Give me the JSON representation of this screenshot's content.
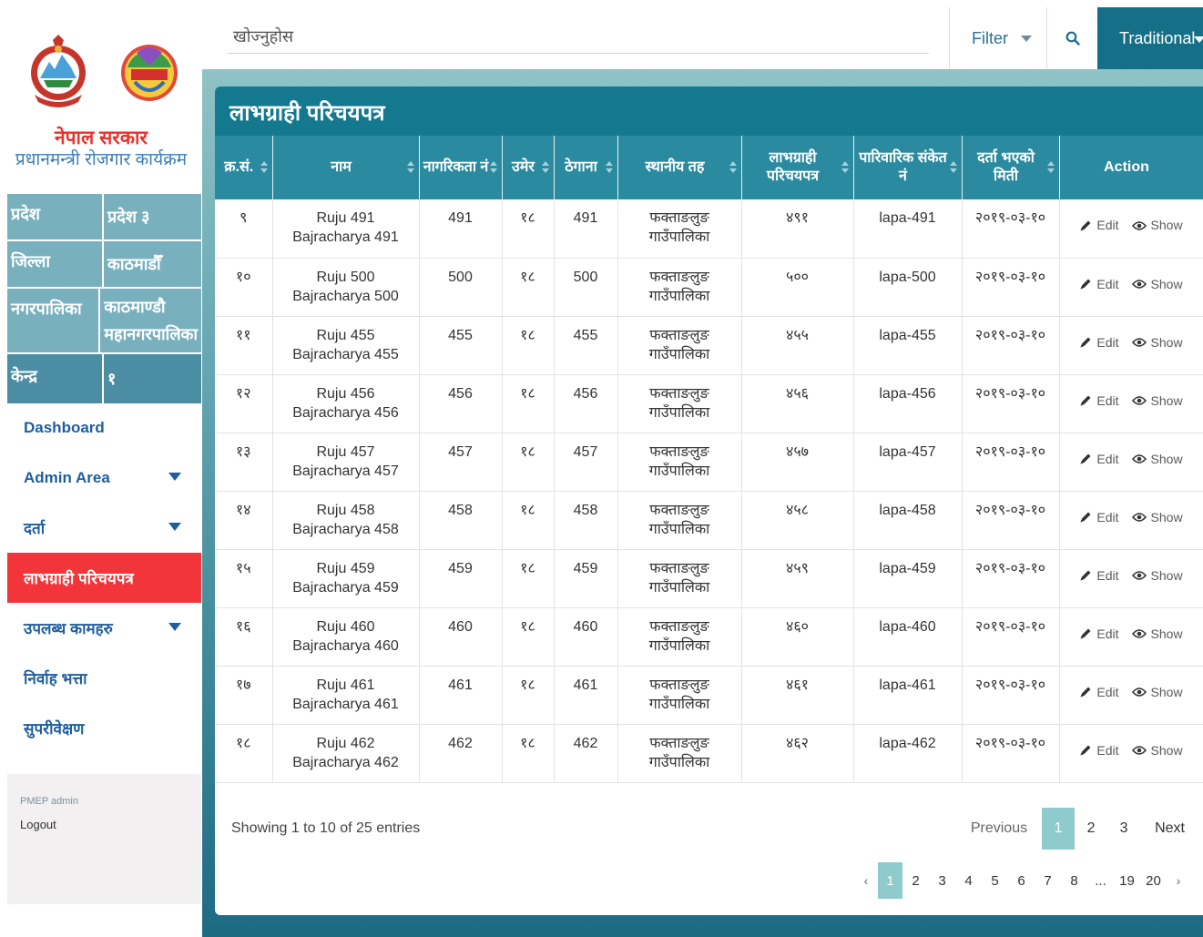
{
  "sidebar": {
    "org_title": "नेपाल सरकार",
    "org_subtitle": "प्रधानमन्त्री रोजगार कार्यक्रम",
    "logo_text": "रोजगार कार्यक्रम",
    "info": [
      {
        "key": "प्रदेश",
        "value": "प्रदेश ३"
      },
      {
        "key": "जिल्ला",
        "value": "काठमाडौँ"
      },
      {
        "key": "नगरपालिका",
        "value": "काठमाण्डौ महानगरपालिका"
      },
      {
        "key": "केन्द्र",
        "value": "१"
      }
    ],
    "nav": [
      {
        "label": "Dashboard"
      },
      {
        "label": "Admin Area"
      },
      {
        "label": "दर्ता"
      },
      {
        "label": "लाभग्राही परिचयपत्र"
      },
      {
        "label": "उपलब्ध कामहरु"
      },
      {
        "label": "निर्वाह भत्ता"
      },
      {
        "label": "सुपरीवेक्षण"
      }
    ],
    "user": "PMEP admin",
    "logout": "Logout"
  },
  "topbar": {
    "search_placeholder": "खोज्नुहोस",
    "filter_label": "Filter",
    "mode_label": "Traditional"
  },
  "card": {
    "title": "लाभग्राही परिचयपत्र",
    "columns": [
      "क्र.सं.",
      "नाम",
      "नागरिकता नं",
      "उमेर",
      "ठेगाना",
      "स्थानीय तह",
      "लाभग्राही परिचयपत्र",
      "पारिवारिक संकेत नं",
      "दर्ता भएको मिती",
      "Action"
    ],
    "rows": [
      {
        "sn": "९",
        "name": "Ruju 491 Bajracharya 491",
        "citizenship": "491",
        "age": "१८",
        "address": "491",
        "local": "फक्ताङलुङ गाउँपालिका",
        "card": "४९१",
        "family": "lapa-491",
        "date": "२०१९-०३-१०"
      },
      {
        "sn": "१०",
        "name": "Ruju 500 Bajracharya 500",
        "citizenship": "500",
        "age": "१८",
        "address": "500",
        "local": "फक्ताङलुङ गाउँपालिका",
        "card": "५००",
        "family": "lapa-500",
        "date": "२०१९-०३-१०"
      },
      {
        "sn": "११",
        "name": "Ruju 455 Bajracharya 455",
        "citizenship": "455",
        "age": "१८",
        "address": "455",
        "local": "फक्ताङलुङ गाउँपालिका",
        "card": "४५५",
        "family": "lapa-455",
        "date": "२०१९-०३-१०"
      },
      {
        "sn": "१२",
        "name": "Ruju 456 Bajracharya 456",
        "citizenship": "456",
        "age": "१८",
        "address": "456",
        "local": "फक्ताङलुङ गाउँपालिका",
        "card": "४५६",
        "family": "lapa-456",
        "date": "२०१९-०३-१०"
      },
      {
        "sn": "१३",
        "name": "Ruju 457 Bajracharya 457",
        "citizenship": "457",
        "age": "१८",
        "address": "457",
        "local": "फक्ताङलुङ गाउँपालिका",
        "card": "४५७",
        "family": "lapa-457",
        "date": "२०१९-०३-१०"
      },
      {
        "sn": "१४",
        "name": "Ruju 458 Bajracharya 458",
        "citizenship": "458",
        "age": "१८",
        "address": "458",
        "local": "फक्ताङलुङ गाउँपालिका",
        "card": "४५८",
        "family": "lapa-458",
        "date": "२०१९-०३-१०"
      },
      {
        "sn": "१५",
        "name": "Ruju 459 Bajracharya 459",
        "citizenship": "459",
        "age": "१८",
        "address": "459",
        "local": "फक्ताङलुङ गाउँपालिका",
        "card": "४५९",
        "family": "lapa-459",
        "date": "२०१९-०३-१०"
      },
      {
        "sn": "१६",
        "name": "Ruju 460 Bajracharya 460",
        "citizenship": "460",
        "age": "१८",
        "address": "460",
        "local": "फक्ताङलुङ गाउँपालिका",
        "card": "४६०",
        "family": "lapa-460",
        "date": "२०१९-०३-१०"
      },
      {
        "sn": "१७",
        "name": "Ruju 461 Bajracharya 461",
        "citizenship": "461",
        "age": "१८",
        "address": "461",
        "local": "फक्ताङलुङ गाउँपालिका",
        "card": "४६१",
        "family": "lapa-461",
        "date": "२०१९-०३-१०"
      },
      {
        "sn": "१८",
        "name": "Ruju 462 Bajracharya 462",
        "citizenship": "462",
        "age": "१८",
        "address": "462",
        "local": "फक्ताङलुङ गाउँपालिका",
        "card": "४६२",
        "family": "lapa-462",
        "date": "२०१९-०३-१०"
      }
    ],
    "edit_label": "Edit",
    "show_label": "Show",
    "summary": "Showing 1 to 10 of 25 entries",
    "pager": {
      "previous": "Previous",
      "pages": [
        "1",
        "2",
        "3"
      ],
      "current": "1",
      "next": "Next"
    },
    "pager2": {
      "prev": "‹",
      "pages": [
        "1",
        "2",
        "3",
        "4",
        "5",
        "6",
        "7",
        "8",
        "...",
        "19",
        "20"
      ],
      "current": "1",
      "next": "›"
    }
  }
}
